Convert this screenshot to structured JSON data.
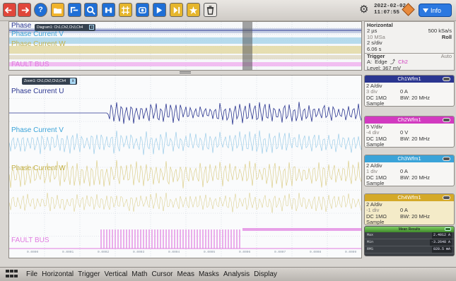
{
  "toolbar": {
    "buttons": [
      {
        "icon": "undo-icon",
        "color": "#e0463a"
      },
      {
        "icon": "redo-icon",
        "color": "#e0463a"
      },
      {
        "icon": "help-icon",
        "color": "#1f6fd6"
      },
      {
        "icon": "folder-icon",
        "color": "#f0b32b"
      },
      {
        "icon": "autoset-icon",
        "color": "#1f6fd6"
      },
      {
        "icon": "zoom-icon",
        "color": "#1f6fd6"
      },
      {
        "icon": "binoculars-icon",
        "color": "#1f6fd6"
      },
      {
        "icon": "grid-marker-icon",
        "color": "#e6b62c"
      },
      {
        "icon": "screenshot-icon",
        "color": "#1f6fd6"
      },
      {
        "icon": "run-single-icon",
        "color": "#1f6fd6"
      },
      {
        "icon": "run-continuous-icon",
        "color": "#e6b62c"
      },
      {
        "icon": "measure-wizard-icon",
        "color": "#e6b62c"
      },
      {
        "icon": "delete-icon",
        "color": "#555555"
      }
    ],
    "date": "2022-02-02",
    "time": "11:07:55",
    "info_label": "Info",
    "info_color": "#2b78e0"
  },
  "overview": {
    "tab_label": "Diagram1: Ch1,Ch2,Ch3,Ch4",
    "tab_close": "x",
    "labels": {
      "ch1": "Phase",
      "ch2": "Phase Current V",
      "ch3": "Phase Current W",
      "fault": "FAULT BUS"
    }
  },
  "zoom": {
    "tab_label": "Zoom1: Ch1,Ch2,Ch3,Ch4",
    "tab_close": "x",
    "labels": {
      "ch1": "Phase Current U",
      "ch2": "Phase Current V",
      "ch3": "Phase Current W",
      "fault": "FAULT BUS"
    },
    "ticks": [
      "0.0000",
      "0.0001",
      "0.0002",
      "0.0003",
      "0.0004",
      "0.0005",
      "0.0006",
      "0.0007",
      "0.0008",
      "0.0009"
    ]
  },
  "colors": {
    "ch1": "#2b3690",
    "ch2": "#3aa3d8",
    "ch3": "#c4b24a",
    "fault": "#e07be0"
  },
  "horizontal": {
    "title": "Horizontal",
    "rows": [
      {
        "left": "2 µs",
        "right": "500 kSa/s"
      },
      {
        "left": "10 MSa",
        "right": "Roll"
      },
      {
        "left": "2 s/div",
        "right": ""
      },
      {
        "left": "6.06 s",
        "right": ""
      }
    ],
    "trigger_title": "Trigger",
    "trigger_mode": "Auto",
    "trigger_line1_a": "A:",
    "trigger_line1_b": "Edge",
    "trigger_channel": "Ch2",
    "trigger_level": "Level: 367 mV"
  },
  "channels": [
    {
      "title": "Ch1Wfm1",
      "color": "#2b3690",
      "scale": "2 A/div",
      "pos": "3 div",
      "offset": "0 A",
      "coupling": "DC 1MΩ",
      "bw": "BW: 20 MHz",
      "mode": "Sample"
    },
    {
      "title": "Ch2Wfm1",
      "color": "#d23ac0",
      "scale": "5 V/div",
      "pos": "-4 div",
      "offset": "0 V",
      "coupling": "DC 1MΩ",
      "bw": "BW: 20 MHz",
      "mode": "Sample"
    },
    {
      "title": "Ch3Wfm1",
      "color": "#3aa3d8",
      "scale": "2 A/div",
      "pos": "1 div",
      "offset": "0 A",
      "coupling": "DC 1MΩ",
      "bw": "BW: 20 MHz",
      "mode": "Sample"
    },
    {
      "title": "Ch4Wfm1",
      "color": "#d4a928",
      "scale": "2 A/div",
      "pos": "-1 div",
      "offset": "0 A",
      "coupling": "DC 1MΩ",
      "bw": "BW: 20 MHz",
      "mode": "Sample"
    }
  ],
  "measurements": {
    "title": "Mean Results",
    "rows": [
      {
        "label": "Max",
        "value": "2.4012 A"
      },
      {
        "label": "Min",
        "value": "-3.2648 A"
      },
      {
        "label": "RMS",
        "value": "828.5 mA"
      }
    ]
  },
  "menu": [
    "File",
    "Horizontal",
    "Trigger",
    "Vertical",
    "Math",
    "Cursor",
    "Meas",
    "Masks",
    "Analysis",
    "Display"
  ]
}
